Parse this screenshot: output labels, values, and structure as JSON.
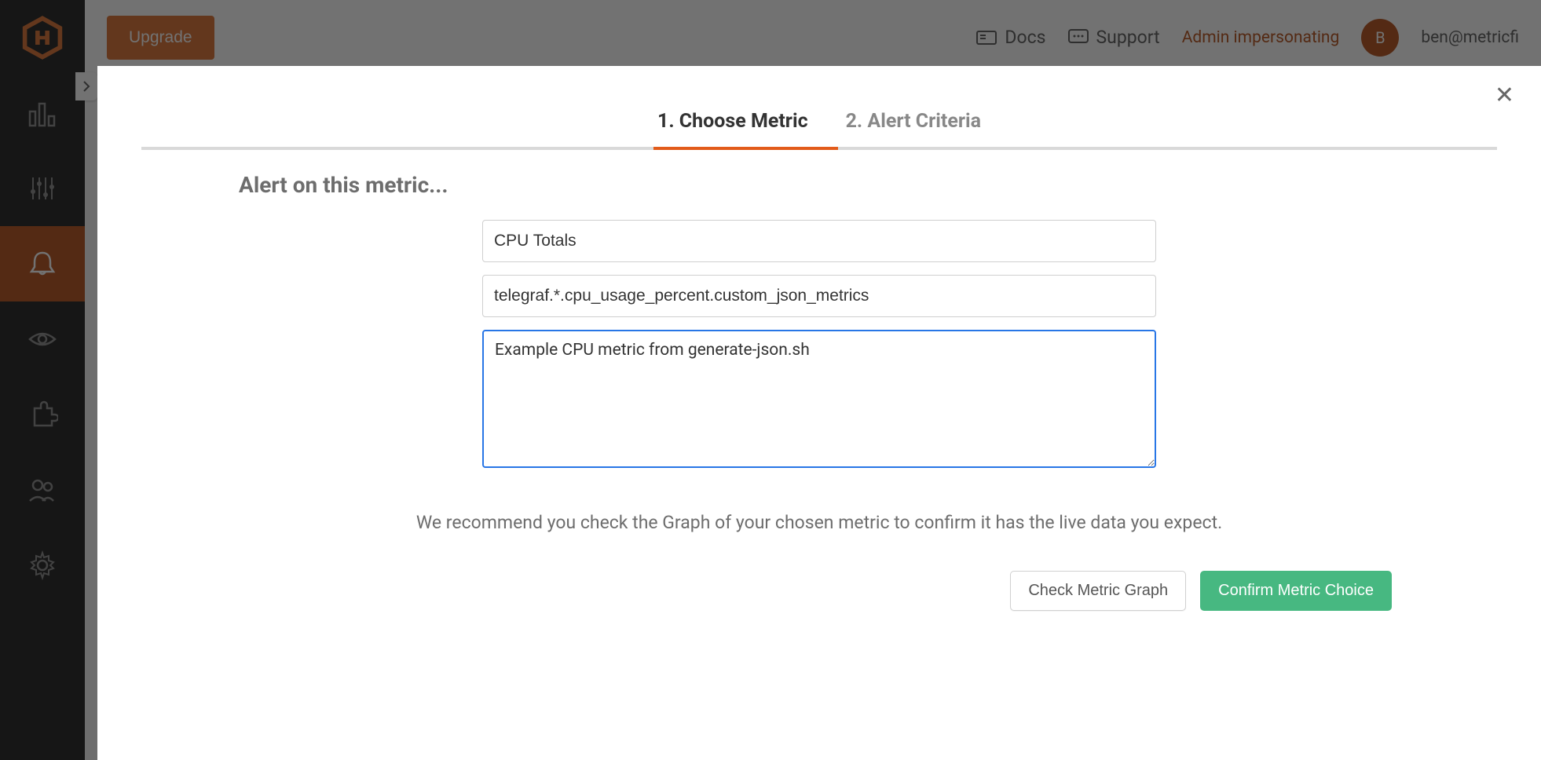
{
  "topbar": {
    "upgrade_label": "Upgrade",
    "docs_label": "Docs",
    "support_label": "Support",
    "impersonating_label": "Admin impersonating",
    "avatar_initial": "B",
    "user_email": "ben@metricfi"
  },
  "modal": {
    "steps": {
      "step1": "1. Choose Metric",
      "step2": "2. Alert Criteria",
      "active_index": 0,
      "indicator_left_pct": 37.8,
      "indicator_width_pct": 13.6
    },
    "section_title": "Alert on this metric...",
    "metric_name_value": "CPU Totals",
    "metric_path_value": "telegraf.*.cpu_usage_percent.custom_json_metrics",
    "description_value": "Example CPU metric from generate-json.sh",
    "recommend_text": "We recommend you check the Graph of your chosen metric to confirm it has the live data you expect.",
    "check_graph_label": "Check Metric Graph",
    "confirm_label": "Confirm Metric Choice",
    "close_glyph": "✕"
  }
}
